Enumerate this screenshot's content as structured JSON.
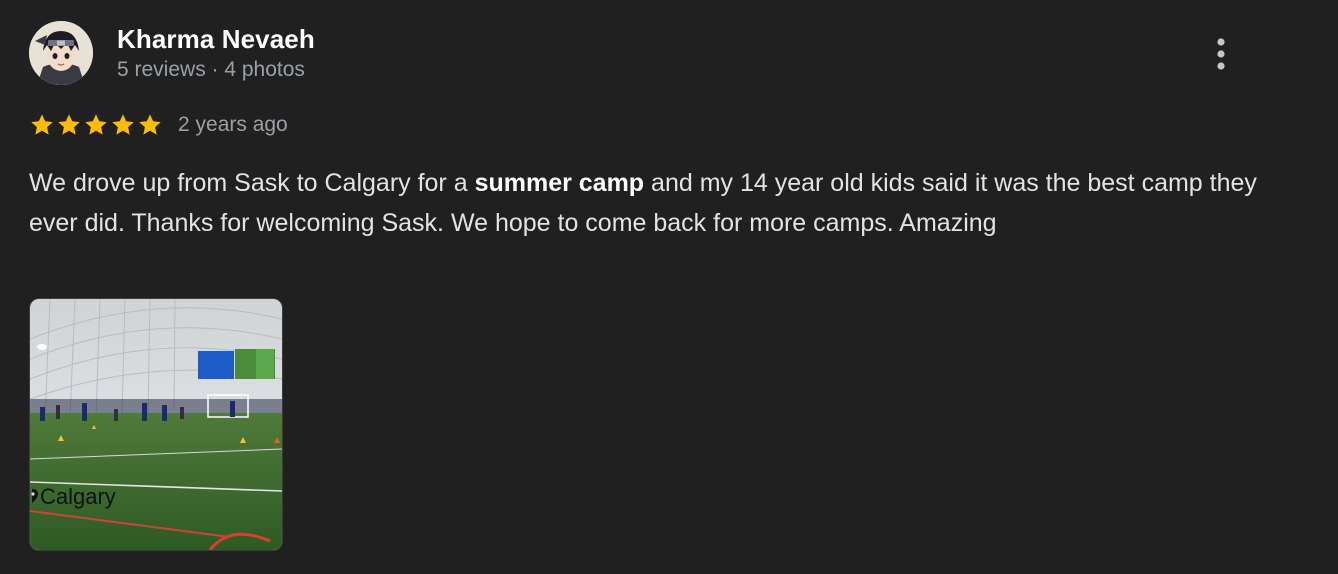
{
  "review": {
    "author": {
      "name": "Kharma Nevaeh",
      "meta": "5 reviews · 4 photos",
      "avatar_icon": "anime-character-avatar"
    },
    "more_icon": "more-vertical-icon",
    "rating": {
      "stars": 5,
      "max": 5,
      "date": "2 years ago",
      "star_color": "#fbbc04"
    },
    "text": {
      "part1": "We drove up from Sask to Calgary for a ",
      "bold": "summer camp",
      "part2": " and my 14 year old kids said it was the best camp they ever did. Thanks for welcoming Sask. We hope to come back for more camps. Amazing"
    },
    "photo": {
      "caption": "Calgary",
      "pin_icon": "location-pin-icon"
    }
  }
}
